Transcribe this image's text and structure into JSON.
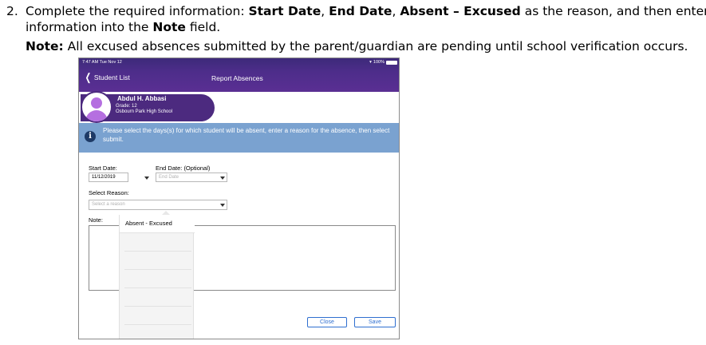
{
  "instructions": {
    "number": "2.",
    "line1_prefix": "Complete the required information: ",
    "start_date": "Start Date",
    "sep1": ", ",
    "end_date": "End Date",
    "sep2": ", ",
    "reason": "Absent – Excused",
    "line1_suffix": " as the reason, and then enter the",
    "line2_prefix": "information into the ",
    "note_word": "Note",
    "line2_suffix": " field.",
    "note_label": "Note:",
    "note_text": " All excused absences submitted by the parent/guardian are pending until school verification occurs."
  },
  "statusbar": {
    "time": "7:47 AM  Tue Nov 12",
    "battery": "100%"
  },
  "nav": {
    "back_label": "Student List",
    "title": "Report Absences"
  },
  "student": {
    "name": "Abdul H. Abbasi",
    "grade": "Grade: 12",
    "school": "Osbourn Park High School"
  },
  "info_banner": {
    "text": "Please select the days(s) for which student will be absent, enter a reason for the absence, then select submit."
  },
  "form": {
    "start_date_label": "Start Date:",
    "start_date_value": "11/12/2019",
    "end_date_label": "End Date: (Optional)",
    "end_date_placeholder": "End Date",
    "reason_label": "Select Reason:",
    "reason_placeholder": "Select a reason",
    "note_label": "Note:"
  },
  "dropdown": {
    "options": [
      "Absent - Excused"
    ]
  },
  "buttons": {
    "close": "Close",
    "save": "Save"
  },
  "colors": {
    "header": "#4d2d8a",
    "banner": "#7aa2d0",
    "button_accent": "#2f6fd0",
    "avatar": "#b56fe0"
  }
}
